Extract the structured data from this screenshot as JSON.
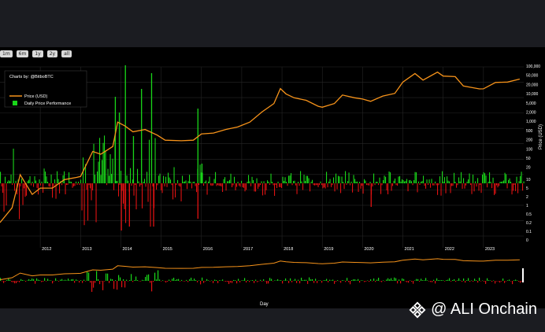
{
  "range_buttons": [
    "1m",
    "6m",
    "1y",
    "2y",
    "all"
  ],
  "chart_credit": "Charts by: @BitboBTC",
  "brand": {
    "text": "@ ALI Onchain"
  },
  "colors": {
    "price": "#f7931a",
    "gain": "#19d619",
    "loss": "#e01212",
    "bg": "#000000"
  },
  "chart_data": [
    {
      "type": "line",
      "title": "",
      "xlabel": "Day",
      "ylabel": "Price (USD)",
      "y_scale": "log",
      "ylim": [
        0.1,
        100000
      ],
      "x_ticks": [
        "2012",
        "2013",
        "2014",
        "2015",
        "2016",
        "2017",
        "2018",
        "2019",
        "2020",
        "2021",
        "2022",
        "2023"
      ],
      "y_ticks_price": [
        "100,000",
        "50,000",
        "20,000",
        "10,000",
        "5,000",
        "2,000",
        "1,000",
        "500",
        "200",
        "100",
        "50",
        "20"
      ],
      "y_ticks_perf": [
        "10",
        "5",
        "2",
        "1",
        "0.5",
        "0.2",
        "0.1",
        "0"
      ],
      "legend": [
        "Price (USD)",
        "Daily Price Performance"
      ],
      "legend_position": "top-left",
      "grid": true,
      "series": [
        {
          "name": "Price (USD)",
          "x": [
            2011.0,
            2011.3,
            2011.5,
            2011.8,
            2012.0,
            2012.3,
            2012.6,
            2012.9,
            2013.0,
            2013.3,
            2013.5,
            2013.8,
            2013.92,
            2014.1,
            2014.3,
            2014.6,
            2014.9,
            2015.1,
            2015.5,
            2015.8,
            2016.0,
            2016.3,
            2016.6,
            2016.9,
            2017.2,
            2017.5,
            2017.8,
            2017.96,
            2018.1,
            2018.3,
            2018.6,
            2018.9,
            2019.0,
            2019.3,
            2019.5,
            2019.8,
            2020.0,
            2020.2,
            2020.5,
            2020.8,
            2021.0,
            2021.3,
            2021.5,
            2021.86,
            2022.0,
            2022.3,
            2022.5,
            2022.9,
            2023.0,
            2023.3,
            2023.6,
            2023.9
          ],
          "values": [
            0.3,
            1,
            15,
            3,
            5,
            5,
            10,
            12,
            13,
            100,
            80,
            150,
            1100,
            800,
            500,
            600,
            380,
            250,
            240,
            250,
            420,
            450,
            600,
            740,
            1100,
            2500,
            5000,
            17000,
            11000,
            8000,
            6500,
            4000,
            3700,
            5000,
            10000,
            8000,
            7200,
            6000,
            9200,
            11500,
            29000,
            58000,
            34000,
            65000,
            47000,
            45000,
            21000,
            16500,
            16600,
            28000,
            29000,
            37000
          ]
        },
        {
          "name": "Daily Price Performance",
          "note": "daily percent change bars; green above zero baseline, red below"
        }
      ]
    }
  ]
}
